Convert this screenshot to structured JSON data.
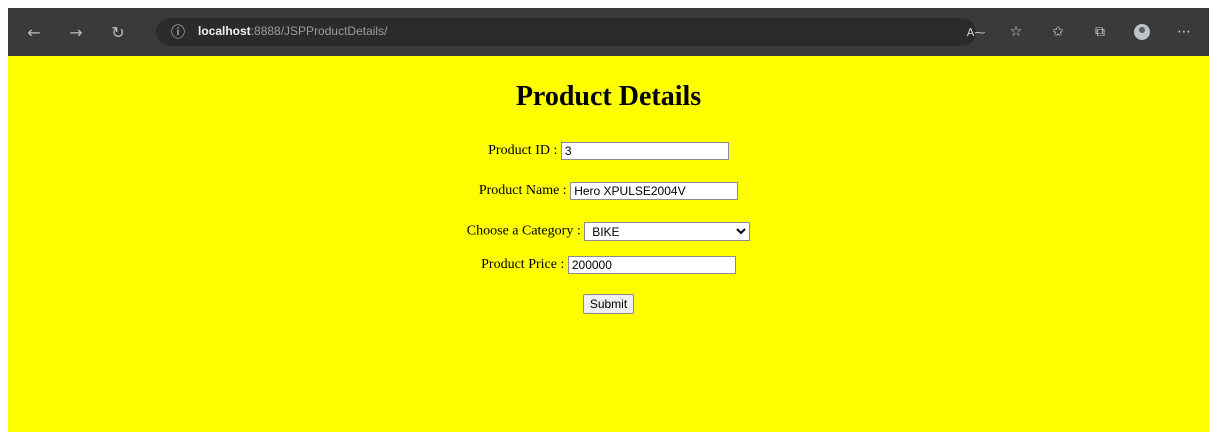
{
  "browser": {
    "url_host": "localhost",
    "url_rest": ":8888/JSPProductDetails/",
    "icons": [
      "back-arrow-icon",
      "forward-arrow-icon",
      "refresh-icon",
      "info-icon",
      "read-aloud-icon",
      "add-favorite-icon",
      "favorites-icon",
      "collections-icon",
      "profile-avatar-icon",
      "more-icon"
    ]
  },
  "form": {
    "title": "Product Details",
    "product_id": {
      "label": "Product ID :",
      "value": "3"
    },
    "product_name": {
      "label": "Product Name :",
      "value": "Hero XPULSE2004V"
    },
    "category": {
      "label": "Choose a Category :",
      "selected": "BIKE"
    },
    "product_price": {
      "label": "Product Price :",
      "value": "200000"
    },
    "submit_label": "Submit"
  },
  "colors": {
    "page_background": "#ffff00",
    "topbar": "#3a3a3a"
  }
}
